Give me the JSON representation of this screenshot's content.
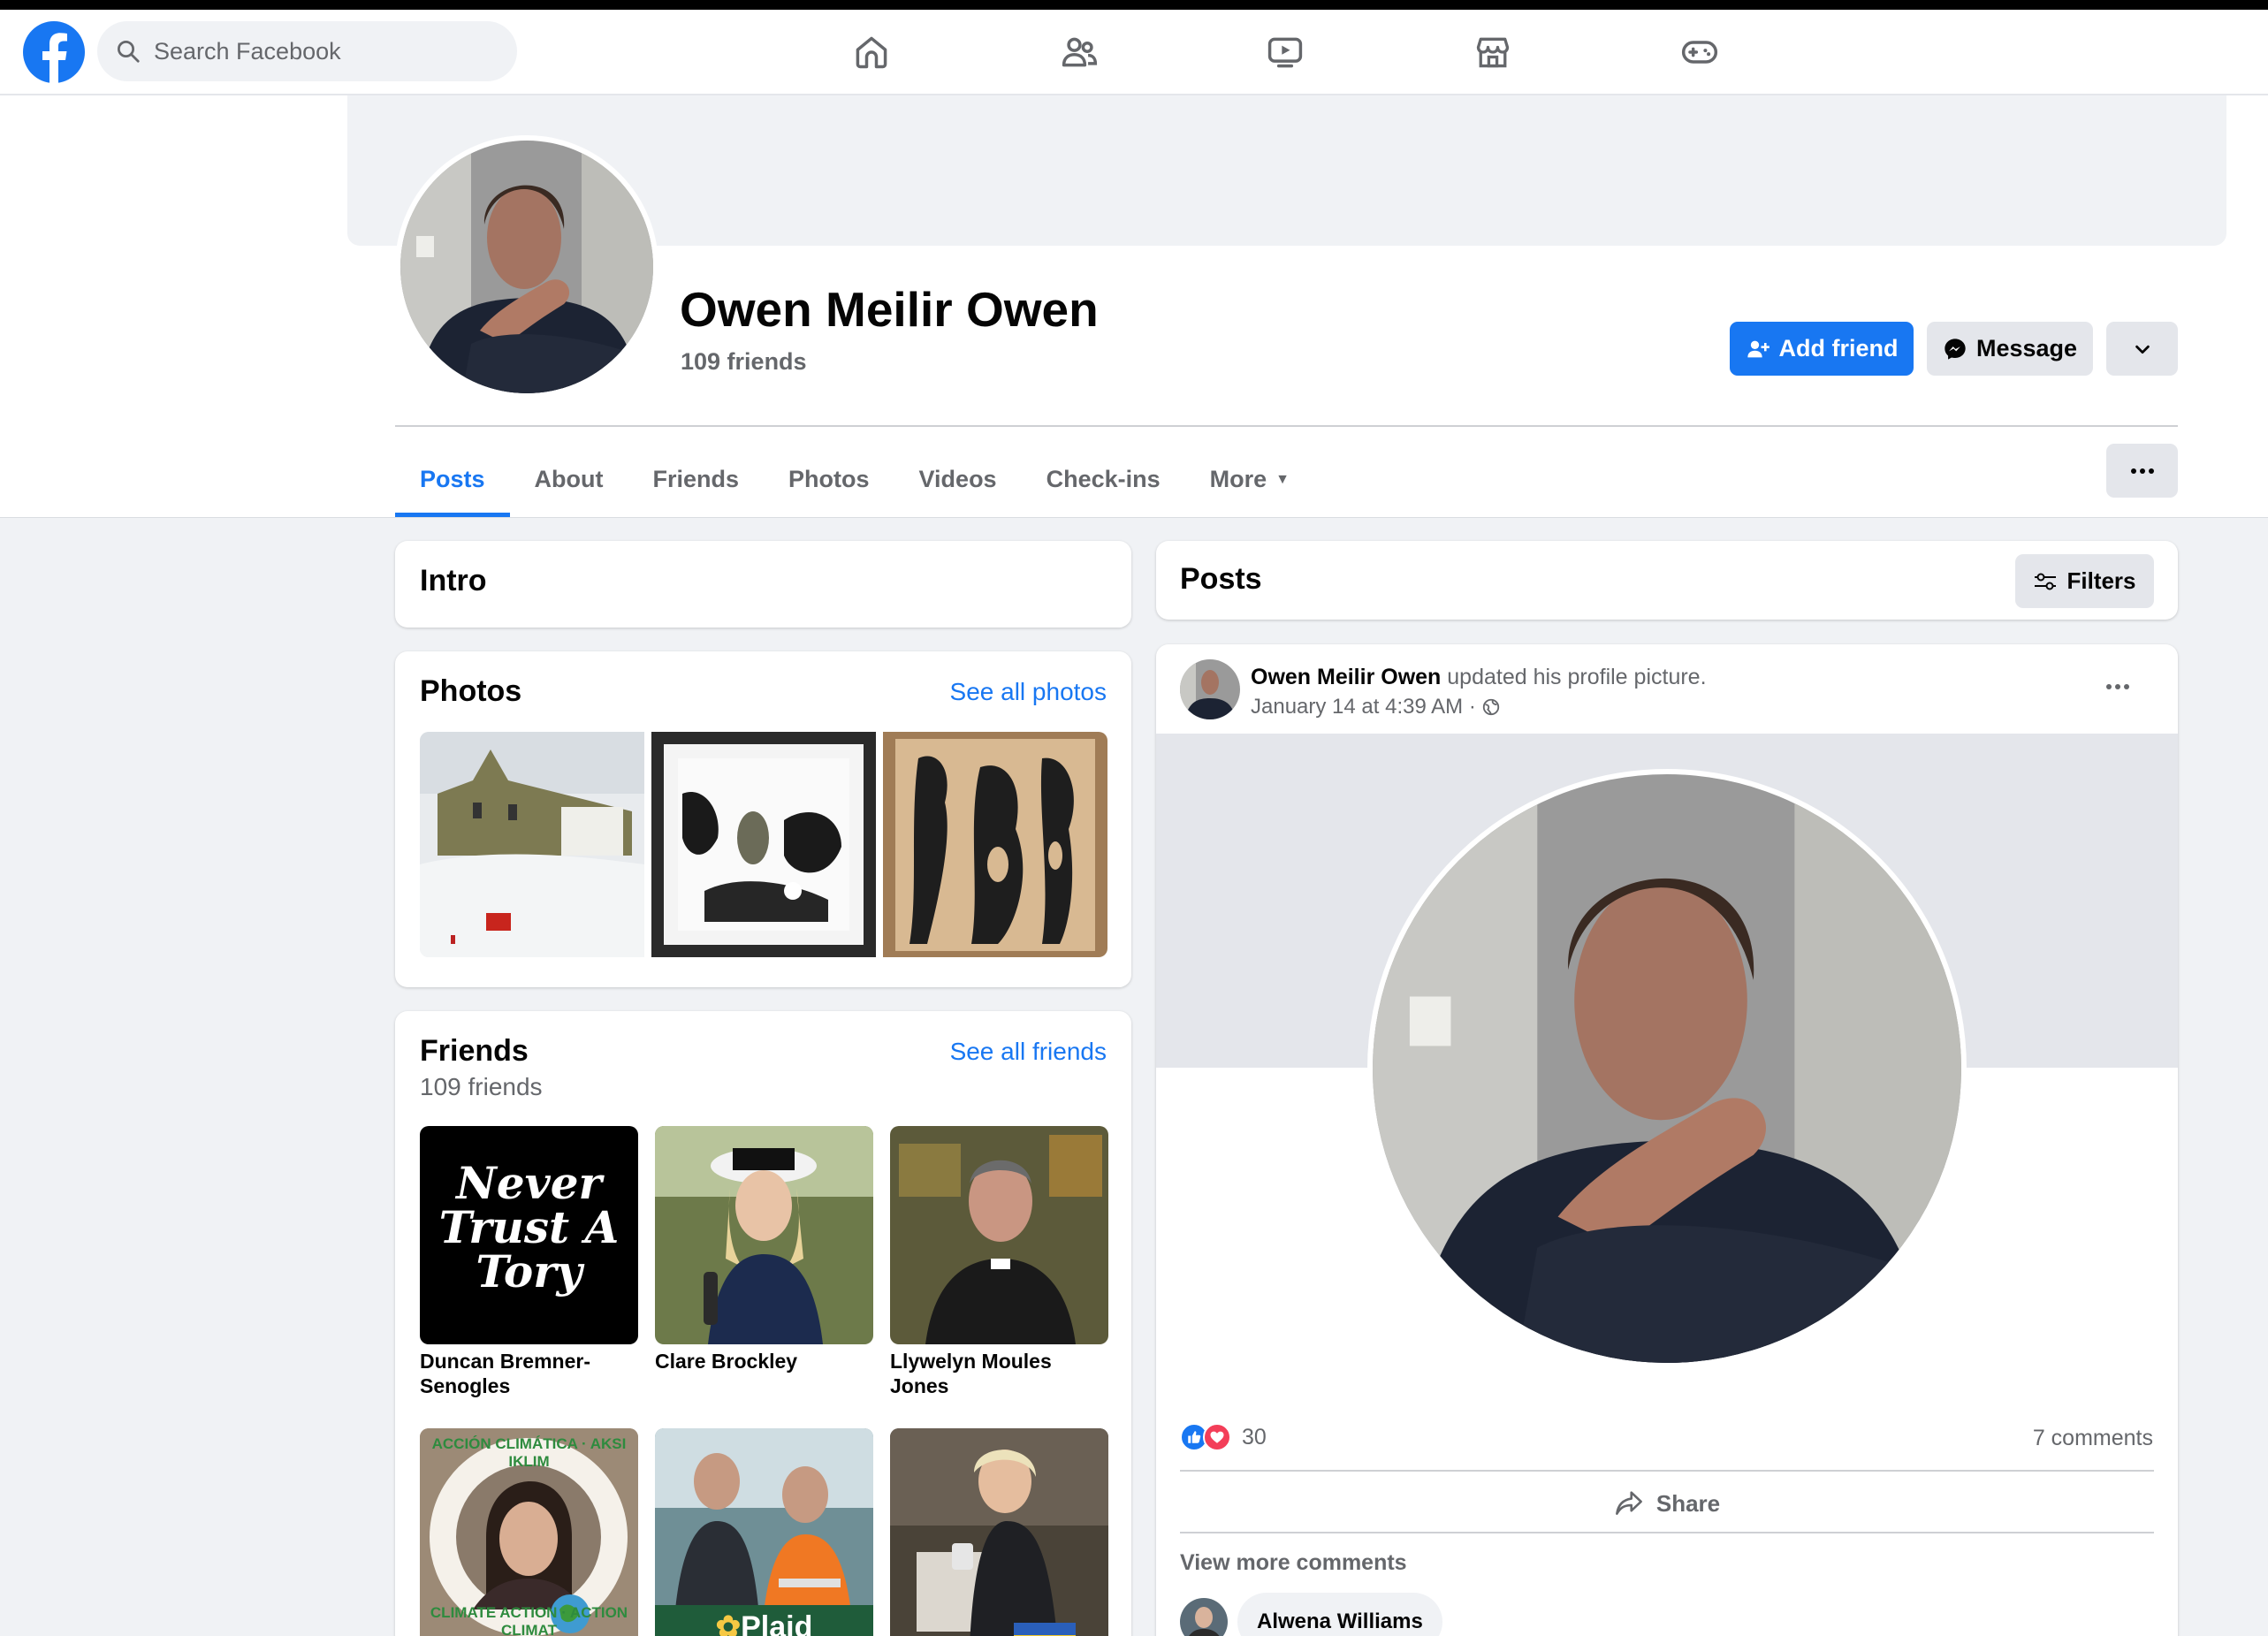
{
  "topbar": {
    "search_placeholder": "Search Facebook",
    "nav_icons": [
      "home-icon",
      "friends-icon",
      "watch-icon",
      "marketplace-icon",
      "gaming-icon"
    ]
  },
  "profile": {
    "name": "Owen Meilir Owen",
    "friends_count": "109 friends",
    "add_friend_label": "Add friend",
    "message_label": "Message"
  },
  "tabs": [
    {
      "label": "Posts",
      "active": true
    },
    {
      "label": "About"
    },
    {
      "label": "Friends"
    },
    {
      "label": "Photos"
    },
    {
      "label": "Videos"
    },
    {
      "label": "Check-ins"
    },
    {
      "label": "More"
    }
  ],
  "intro": {
    "title": "Intro"
  },
  "photos": {
    "title": "Photos",
    "see_all": "See all photos"
  },
  "friends": {
    "title": "Friends",
    "count": "109 friends",
    "see_all": "See all friends",
    "list": [
      {
        "name": "Duncan Bremner-Senogles",
        "tile_text": "Never Trust A Tory"
      },
      {
        "name": "Clare Brockley"
      },
      {
        "name": "Llywelyn Moules Jones"
      },
      {
        "name": "",
        "ring_top": "ACCIÓN CLIMÁTICA · AKSI IKLIM",
        "ring_bottom": "CLIMATE ACTION · ACTION CLIMAT"
      },
      {
        "name": "",
        "banner": "Plaid"
      },
      {
        "name": ""
      }
    ]
  },
  "posts": {
    "title": "Posts",
    "filters_label": "Filters",
    "post": {
      "author": "Owen Meilir Owen",
      "action": "updated his profile picture.",
      "time": "January 14 at 4:39 AM ·",
      "reaction_count": "30",
      "comments": "7 comments",
      "share_label": "Share",
      "view_more": "View more comments",
      "commenter": "Alwena Williams"
    }
  },
  "colors": {
    "accent": "#1877f2",
    "background": "#f0f2f5",
    "button_gray": "#e4e6eb"
  }
}
